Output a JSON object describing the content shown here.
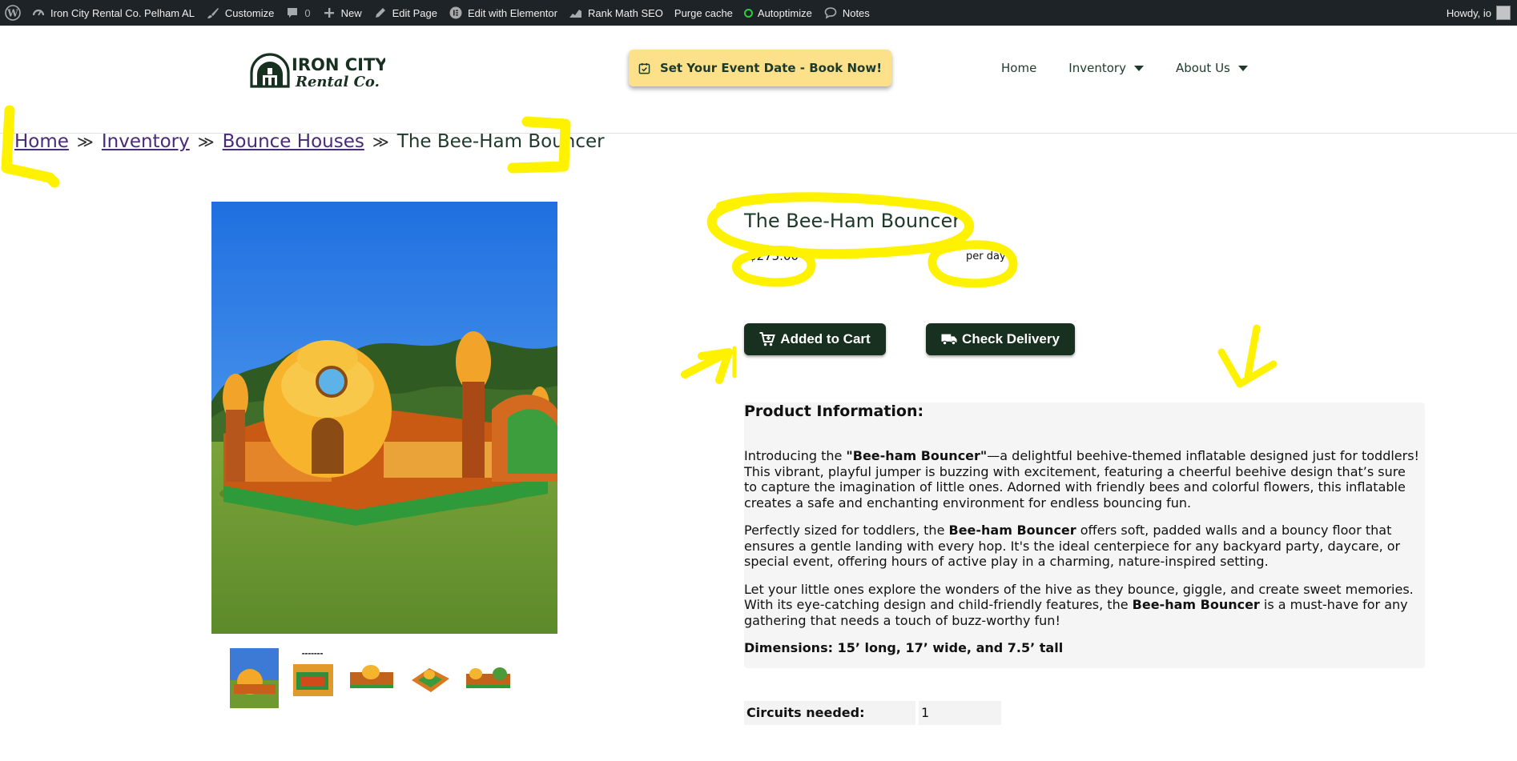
{
  "admin_bar": {
    "site_name": "Iron City Rental Co. Pelham AL",
    "customize": "Customize",
    "comments_count": "0",
    "new": "New",
    "edit_page": "Edit Page",
    "edit_elementor": "Edit with Elementor",
    "rank_math": "Rank Math SEO",
    "purge_cache": "Purge cache",
    "autoptimize": "Autoptimize",
    "notes": "Notes",
    "howdy": "Howdy, io"
  },
  "header": {
    "logo_line1": "IRON CITY",
    "logo_line2": "Rental Co.",
    "book_button": "Set Your Event Date - Book Now!",
    "nav": {
      "home": "Home",
      "inventory": "Inventory",
      "about": "About Us"
    }
  },
  "breadcrumb": {
    "home": "Home",
    "inventory": "Inventory",
    "bounce_houses": "Bounce Houses",
    "current": "The Bee-Ham Bouncer"
  },
  "product": {
    "title": "The Bee-Ham Bouncer",
    "price": "$275.00",
    "per_day": "per day",
    "added_to_cart": "Added to Cart",
    "check_delivery": "Check Delivery",
    "info_heading": "Product Information:",
    "p1_a": "Introducing the ",
    "p1_b": "\"Bee-ham Bouncer\"",
    "p1_c": "—a delightful beehive-themed inflatable designed just for toddlers! This vibrant, playful jumper is buzzing with excitement, featuring a cheerful beehive design that’s sure to capture the imagination of little ones. Adorned with friendly bees and colorful flowers, this inflatable creates a safe and enchanting environment for endless bouncing fun.",
    "p2_a": "Perfectly sized for toddlers, the ",
    "p2_b": "Bee-ham Bouncer",
    "p2_c": " offers soft, padded walls and a bouncy floor that ensures a gentle landing with every hop. It's the ideal centerpiece for any backyard party, daycare, or special event, offering hours of active play in a charming, nature-inspired setting.",
    "p3_a": "Let your little ones explore the wonders of the hive as they bounce, giggle, and create sweet memories. With its eye-catching design and child-friendly features, the ",
    "p3_b": "Bee-ham Bouncer",
    "p3_c": " is a must-have for any gathering that needs a touch of buzz-worthy fun!",
    "dimensions": "Dimensions: 15’ long, 17’ wide, and 7.5’ tall",
    "circuits_label": "Circuits needed:",
    "circuits_value": "1"
  },
  "colors": {
    "admin_bar": "#1d2327",
    "brand_green": "#17301f",
    "book_yellow": "#fde18a",
    "annotation_yellow": "#fff200",
    "link_purple": "#4a2a7a"
  }
}
